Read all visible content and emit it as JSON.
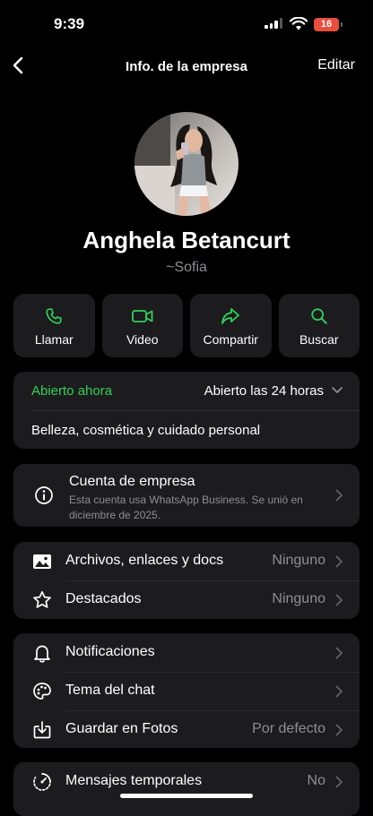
{
  "status_bar": {
    "time": "9:39",
    "battery": "16"
  },
  "nav": {
    "title": "Info. de la empresa",
    "edit_label": "Editar"
  },
  "profile": {
    "name": "Anghela Betancurt",
    "pushname": "~Sofia"
  },
  "actions": [
    {
      "label": "Llamar",
      "icon": "phone-icon"
    },
    {
      "label": "Video",
      "icon": "video-icon"
    },
    {
      "label": "Compartir",
      "icon": "share-icon"
    },
    {
      "label": "Buscar",
      "icon": "search-icon"
    }
  ],
  "business_hours": {
    "status": "Abierto ahora",
    "hours": "Abierto las 24 horas",
    "category": "Belleza, cosmética y cuidado personal"
  },
  "business_account": {
    "title": "Cuenta de empresa",
    "description": "Esta cuenta usa WhatsApp Business. Se unió en diciembre de 2025."
  },
  "media": [
    {
      "label": "Archivos, enlaces y docs",
      "value": "Ninguno",
      "icon": "photo-icon"
    },
    {
      "label": "Destacados",
      "value": "Ninguno",
      "icon": "star-icon"
    }
  ],
  "settings": [
    {
      "label": "Notificaciones",
      "value": "",
      "icon": "bell-icon"
    },
    {
      "label": "Tema del chat",
      "value": "",
      "icon": "palette-icon"
    },
    {
      "label": "Guardar en Fotos",
      "value": "Por defecto",
      "icon": "save-download-icon"
    }
  ],
  "privacy": [
    {
      "label": "Mensajes temporales",
      "value": "No",
      "icon": "timer-icon"
    }
  ],
  "colors": {
    "accent": "#30d158",
    "background": "#000000",
    "card": "#1c1c1e",
    "secondary_text": "#8e8e93",
    "battery": "#eb4d3d"
  }
}
